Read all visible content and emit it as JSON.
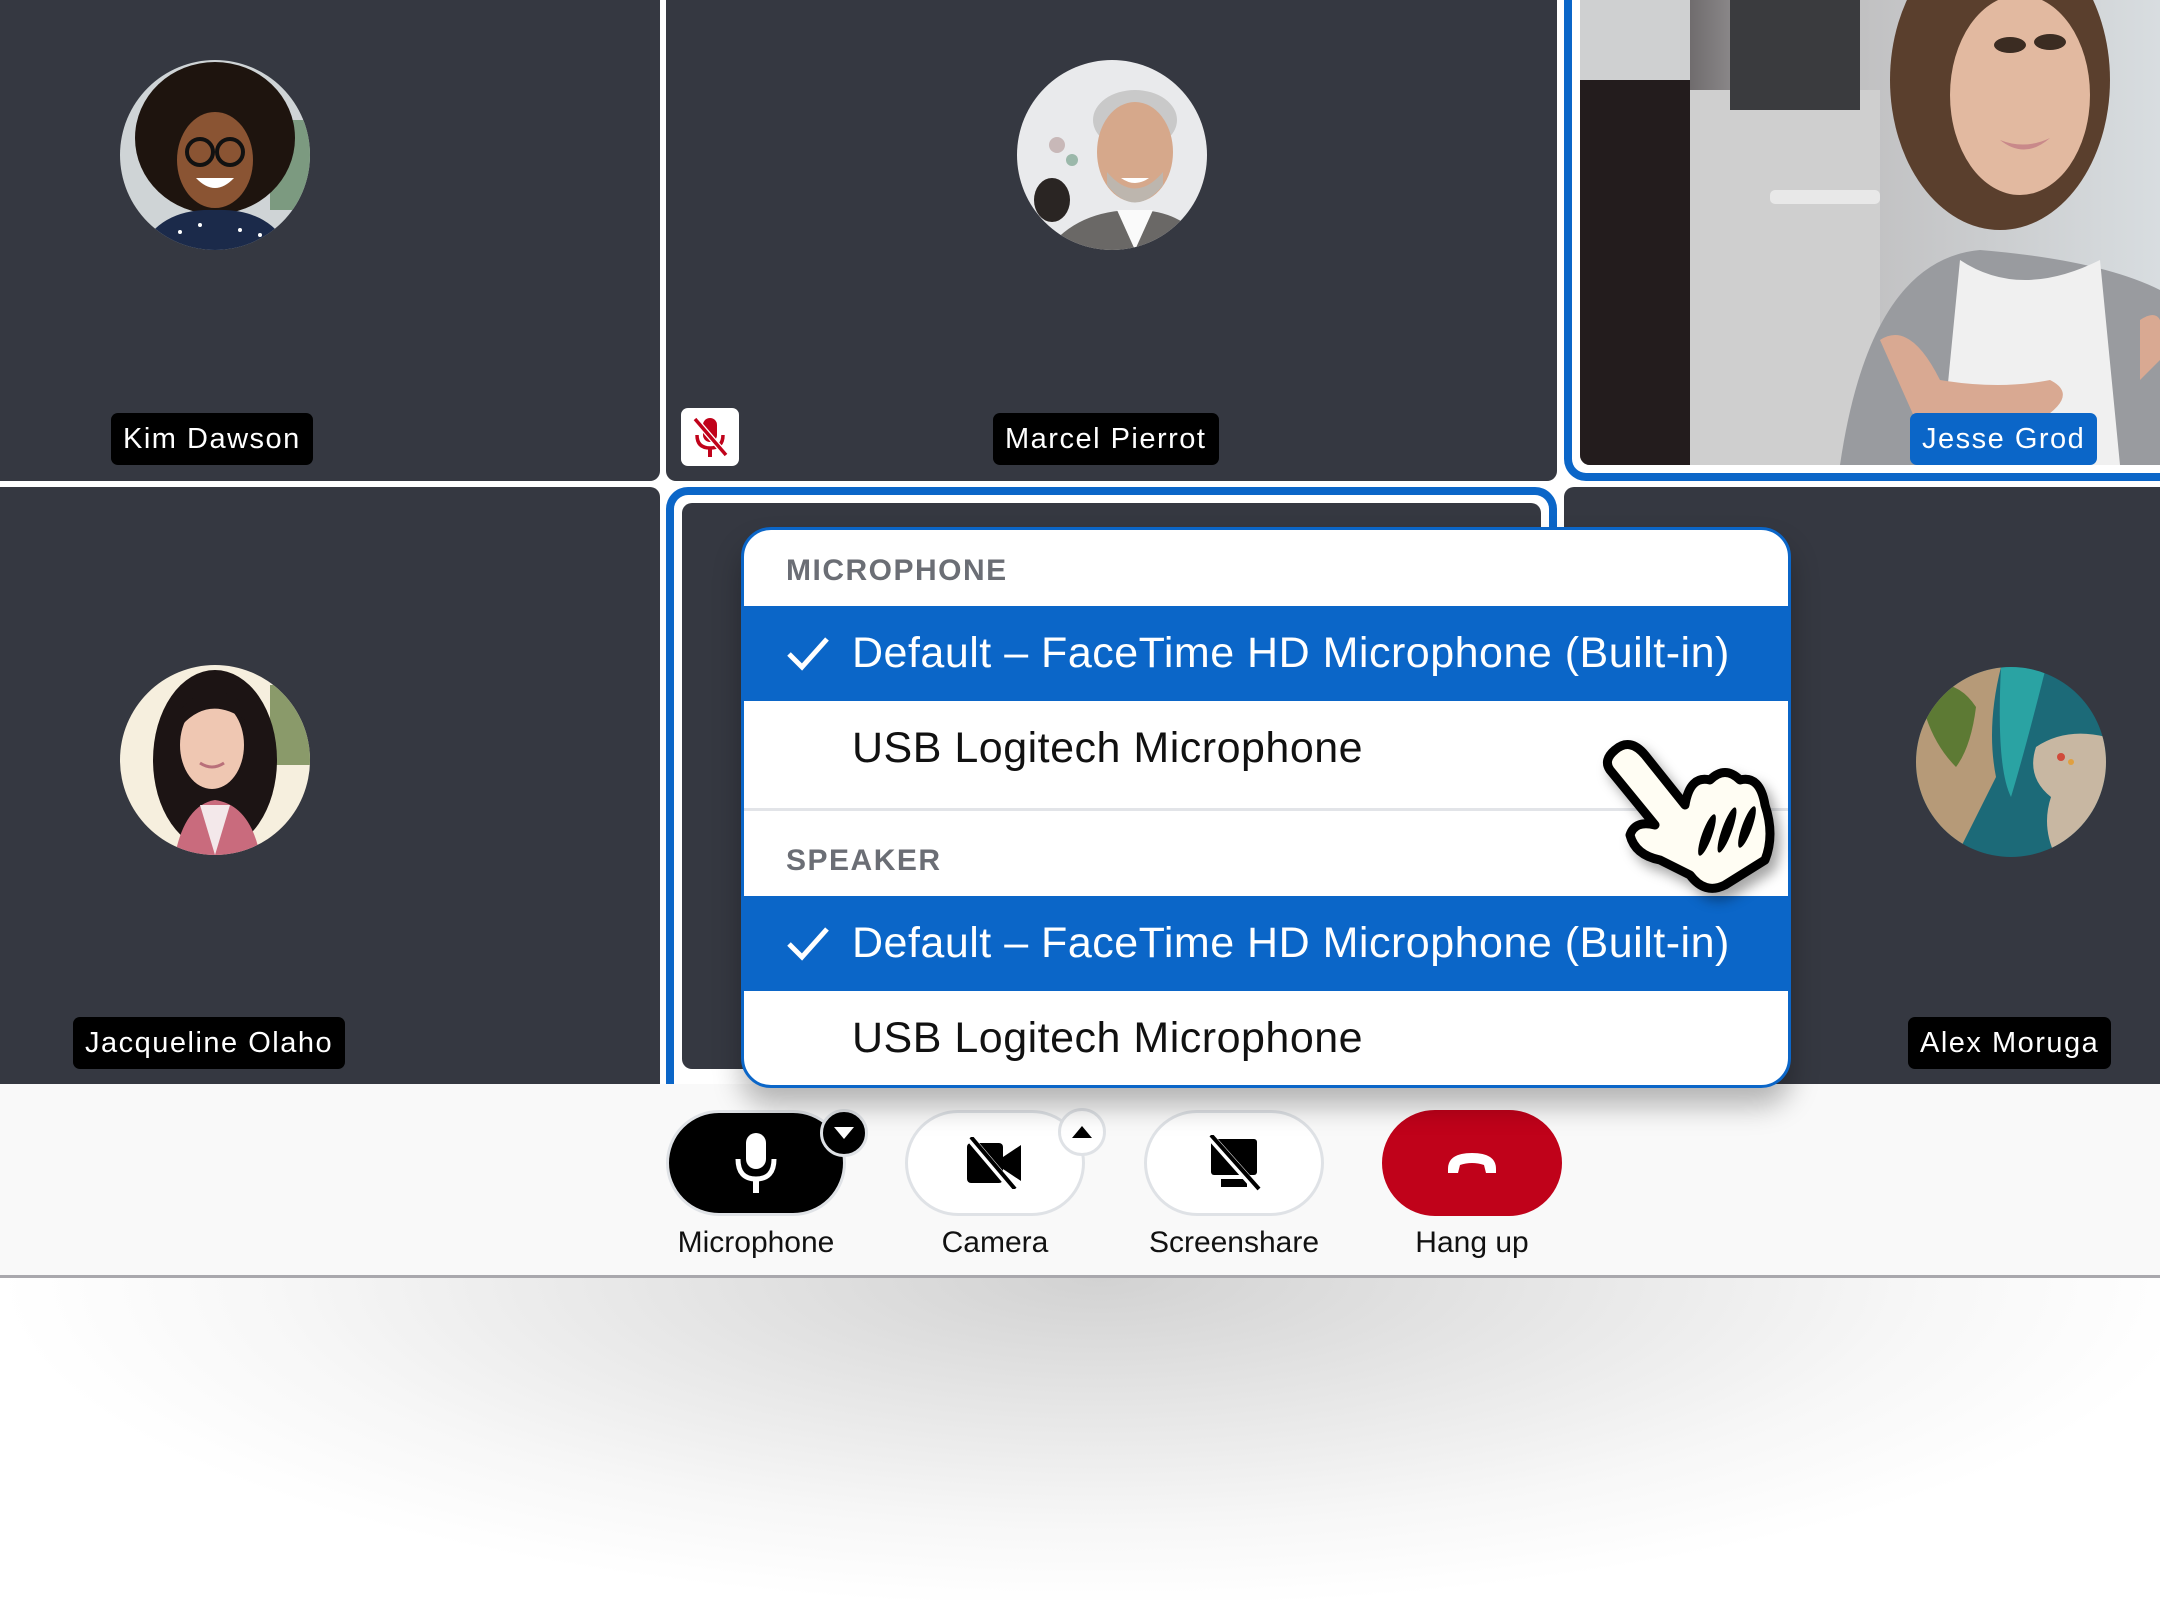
{
  "participants": [
    {
      "name": "Kim Dawson",
      "active": false,
      "muted": false,
      "video": false
    },
    {
      "name": "Marcel Pierrot",
      "active": false,
      "muted": true,
      "video": false
    },
    {
      "name": "Jesse Grod",
      "active": true,
      "muted": false,
      "video": true
    },
    {
      "name": "Jacqueline Olaho",
      "active": false,
      "muted": false,
      "video": false
    },
    {
      "name": "",
      "active": false,
      "muted": false,
      "video": false,
      "focused": true
    },
    {
      "name": "Alex Moruga",
      "active": false,
      "muted": false,
      "video": false
    }
  ],
  "device_menu": {
    "sections": [
      {
        "header": "MICROPHONE",
        "items": [
          {
            "label": "Default – FaceTime HD Microphone (Built-in)",
            "selected": true
          },
          {
            "label": "USB Logitech Microphone",
            "selected": false
          }
        ]
      },
      {
        "header": "SPEAKER",
        "items": [
          {
            "label": "Default – FaceTime HD Microphone (Built-in)",
            "selected": true
          },
          {
            "label": "USB Logitech Microphone",
            "selected": false
          }
        ]
      }
    ]
  },
  "controls": {
    "microphone": {
      "label": "Microphone",
      "icon": "microphone-icon",
      "state": "on",
      "caret": "down"
    },
    "camera": {
      "label": "Camera",
      "icon": "camera-off-icon",
      "state": "off",
      "caret": "up"
    },
    "screenshare": {
      "label": "Screenshare",
      "icon": "screenshare-off-icon",
      "state": "off"
    },
    "hangup": {
      "label": "Hang up",
      "icon": "phone-hangup-icon"
    }
  },
  "colors": {
    "accent": "#0b66c8",
    "tile_bg": "#353841",
    "danger": "#c0021a",
    "muted_icon": "#c0021a"
  }
}
